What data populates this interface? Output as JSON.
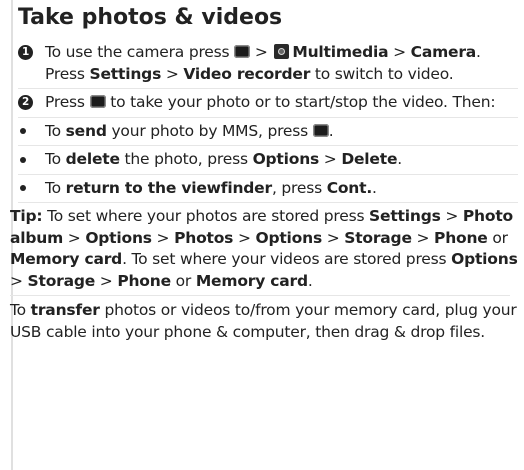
{
  "title": "Take photos & videos",
  "steps": [
    {
      "marker": "1",
      "t1": "To use the camera press ",
      "t2": " > ",
      "b1": "Multimedia",
      "t3": " > ",
      "b2": "Camera",
      "t4": ". Press ",
      "b3": "Settings",
      "t5": " > ",
      "b4": "Video recorder",
      "t6": " to switch to video."
    },
    {
      "marker": "2",
      "t1": "Press ",
      "t2": " to take your photo or to start/stop the video. Then:"
    }
  ],
  "bullets": [
    {
      "t1": "To ",
      "b1": "send",
      "t2": " your photo by MMS, press ",
      "t3": "."
    },
    {
      "t1": "To ",
      "b1": "delete",
      "t2": " the photo, press ",
      "b2": "Options",
      "t3": " > ",
      "b3": "Delete",
      "t4": "."
    },
    {
      "t1": "To ",
      "b1": "return to the viewfinder",
      "t2": ", press ",
      "b2": "Cont.",
      "t3": "."
    }
  ],
  "tip": {
    "label": "Tip:",
    "t1": " To set where your photos are stored press ",
    "b1": "Settings",
    "t2": " > ",
    "b2": "Photo album",
    "t3": " > ",
    "b3": "Options",
    "t4": " > ",
    "b4": "Photos",
    "t5": " > ",
    "b5": "Options",
    "t6": " > ",
    "b6": "Storage",
    "t7": " > ",
    "b7": "Phone",
    "t8": " or ",
    "b8": "Memory card",
    "t9": ". To set where your videos are stored press ",
    "b9": "Options",
    "t10": " > ",
    "b10": "Storage",
    "t11": " > ",
    "b11": "Phone",
    "t12": " or ",
    "b12": "Memory card",
    "t13": "."
  },
  "transfer": {
    "t1": "To ",
    "b1": "transfer",
    "t2": " photos or videos to/from your memory card, plug your USB cable into your phone & computer, then drag & drop files."
  },
  "icons": {
    "menu_key": "menu-key-icon",
    "multimedia": "multimedia-icon"
  }
}
